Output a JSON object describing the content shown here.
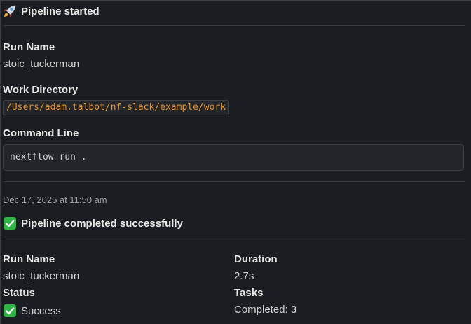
{
  "start_message": {
    "title": "Pipeline started",
    "icon": "rocket-icon",
    "run_name_label": "Run Name",
    "run_name": "stoic_tuckerman",
    "work_dir_label": "Work Directory",
    "work_dir": "/Users/adam.talbot/nf-slack/example/work",
    "command_line_label": "Command Line",
    "command_line": "nextflow run ."
  },
  "timestamp": "Dec 17, 2025 at 11:50 am",
  "completion_message": {
    "title": "Pipeline completed successfully",
    "icon": "check-mark-icon",
    "left": {
      "run_name_label": "Run Name",
      "run_name": "stoic_tuckerman",
      "status_label": "Status",
      "status_value": "Success"
    },
    "right": {
      "duration_label": "Duration",
      "duration": "2.7s",
      "tasks_label": "Tasks",
      "tasks_value": "Completed: 3"
    }
  },
  "colors": {
    "background": "#1a1d21",
    "text": "#d1d2d3",
    "code_text": "#e8912d",
    "success_green": "#2fb344"
  }
}
